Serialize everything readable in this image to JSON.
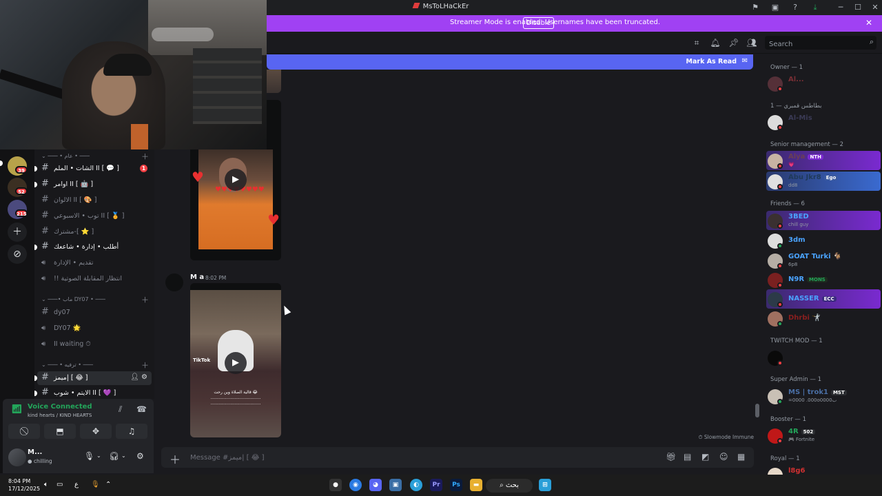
{
  "window": {
    "title": "MsToLHaCkEr"
  },
  "streamer": {
    "message": "Streamer Mode is enabled. Usernames have been truncated.",
    "disable_label": "Disable"
  },
  "header": {
    "search_placeholder": "Search"
  },
  "banner": {
    "mark_read_label": "Mark As Read"
  },
  "rail": {
    "servers": [
      {
        "badge": "39",
        "color": "#b8a24a"
      },
      {
        "badge": "52",
        "color": "#3b2f22"
      },
      {
        "badge": "215",
        "color": "#4b4a7e"
      }
    ]
  },
  "channels": {
    "categories": [
      {
        "label": "─── • عام • ───"
      },
      {
        "label": "───• ماب DY07 • ───"
      },
      {
        "label": "─── • ترفيه • ───"
      }
    ],
    "items": [
      {
        "name": "الشات • الملم II [ 💬 ]",
        "mention": "1"
      },
      {
        "name": "اوامر II [ 🤖 ]"
      },
      {
        "name": "الالوان II [ 🎨 ]"
      },
      {
        "name": "توب • الاسبوعي II [ 🏅 ]"
      },
      {
        "name": "مشترك-[ ⭐ ]"
      },
      {
        "name": "أطلب • إدارة • شاععك"
      },
      {
        "name": "تقديم • الإدارة"
      },
      {
        "name": "!! انتظار المقابلة الصوتية"
      },
      {
        "name": "dy07"
      },
      {
        "name": "DY07 🌟"
      },
      {
        "name": "II waiting ⏱"
      },
      {
        "name": "ميمز| [ 😂 ]"
      },
      {
        "name": "الايتم • شوب II [ 💜 ]"
      }
    ]
  },
  "voice": {
    "status": "Voice Connected",
    "sub": "kind hearts / KIND HEARTS"
  },
  "user": {
    "name": "M...",
    "status": "chilling"
  },
  "chat": {
    "author": "M a",
    "time": "8:02 PM",
    "caption": "قالية الصلاة وين رحت 😂 ...................................... ......................................",
    "tiktok": "TikTok",
    "slowmode": "Slowmode Immune",
    "composer_placeholder": "Message #ميمز| [ 😂 ]"
  },
  "members": {
    "groups": [
      {
        "label": "Owner — 1"
      },
      {
        "label": "بطاطس قمبري — 1"
      },
      {
        "label": "Senior management — 2"
      },
      {
        "label": "Friends — 6"
      },
      {
        "label": "TWITCH MOD — 1"
      },
      {
        "label": "Super Admin — 1"
      },
      {
        "label": "Booster — 1"
      },
      {
        "label": "Royal — 1"
      }
    ],
    "list": [
      {
        "name": "Al...",
        "sub": "",
        "color": "#7a2f35",
        "tag": ""
      },
      {
        "name": "Al-Mis",
        "sub": "",
        "color": "#3a3a55",
        "tag": ""
      },
      {
        "name": "Alya",
        "sub": "💗",
        "color": "#6a3f55",
        "tag": "NTH"
      },
      {
        "name": "Abu Jkr8",
        "sub": "dd8",
        "color": "#1f3a5a",
        "tag": "Ego"
      },
      {
        "name": "3BED",
        "sub": "chill guy",
        "color": "#4aa3ff",
        "tag": ""
      },
      {
        "name": "3dm",
        "sub": "",
        "color": "#4aa3ff",
        "tag": ""
      },
      {
        "name": "GOAT Turki 🐐",
        "sub": "6p8",
        "color": "#4aa3ff",
        "tag": ""
      },
      {
        "name": "N9R",
        "sub": "",
        "color": "#4aa3ff",
        "tag": "MONS"
      },
      {
        "name": "NASSER",
        "sub": "",
        "color": "#4aa3ff",
        "tag": "ECC"
      },
      {
        "name": "Dhrbi 🤺",
        "sub": "",
        "color": "#8a1f1f",
        "tag": ""
      },
      {
        "name": "",
        "sub": "",
        "color": "#0a0a0a",
        "tag": ""
      },
      {
        "name": "MS | trok1",
        "sub": "=0000 .000o0000ب",
        "color": "#4a6fa5",
        "tag": "MST"
      },
      {
        "name": "4R",
        "sub": "Fortnite",
        "color": "#23a55a",
        "tag": "502"
      },
      {
        "name": "l8g6",
        "sub": "",
        "color": "#d03030",
        "tag": ""
      }
    ]
  },
  "taskbar": {
    "time": "8:04 PM",
    "date": "17/12/2025",
    "lang": "ع",
    "search": "بحث"
  }
}
